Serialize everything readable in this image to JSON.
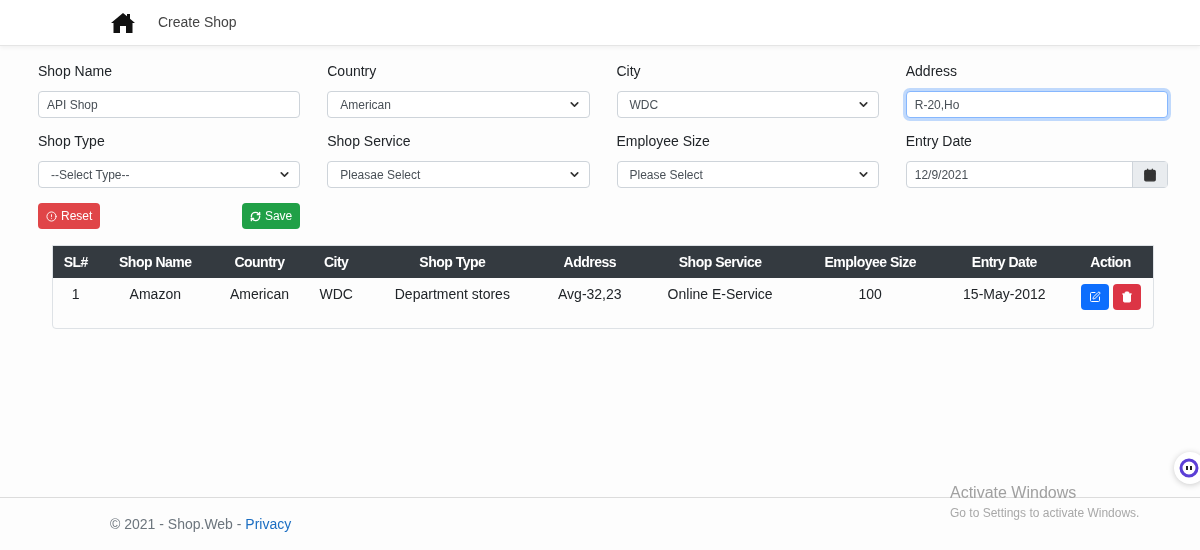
{
  "navbar": {
    "title": "Create Shop"
  },
  "form": {
    "fields": [
      {
        "label": "Shop Name",
        "kind": "text",
        "value": "API Shop",
        "focused": false
      },
      {
        "label": "Country",
        "kind": "select",
        "value": "American",
        "focused": false
      },
      {
        "label": "City",
        "kind": "select",
        "value": "WDC",
        "focused": false
      },
      {
        "label": "Address",
        "kind": "textarea",
        "value": "R-20,Ho",
        "focused": true
      },
      {
        "label": "Shop Type",
        "kind": "select",
        "value": "--Select Type--",
        "focused": false
      },
      {
        "label": "Shop Service",
        "kind": "select",
        "value": "Pleasae Select",
        "focused": false
      },
      {
        "label": "Employee Size",
        "kind": "select",
        "value": "Please Select",
        "focused": false
      },
      {
        "label": "Entry Date",
        "kind": "date",
        "value": "12/9/2021",
        "focused": false
      }
    ],
    "buttons": [
      {
        "label": "Reset",
        "kind": "reset"
      },
      {
        "label": "Save",
        "kind": "save"
      }
    ]
  },
  "table": {
    "columns": [
      "SL#",
      "Shop Name",
      "Country",
      "City",
      "Shop Type",
      "Address",
      "Shop Service",
      "Employee Size",
      "Entry Date",
      "Action"
    ],
    "rows": [
      {
        "cells": [
          "1",
          "Amazon",
          "American",
          "WDC",
          "Department stores",
          "Avg-32,23",
          "Online E-Service",
          "100",
          "15-May-2012"
        ]
      }
    ]
  },
  "footer": {
    "text": "© 2021 - Shop.Web -",
    "link": "Privacy"
  },
  "os_notice": {
    "title": "Activate Windows",
    "message": "Go to Settings to activate Windows."
  }
}
